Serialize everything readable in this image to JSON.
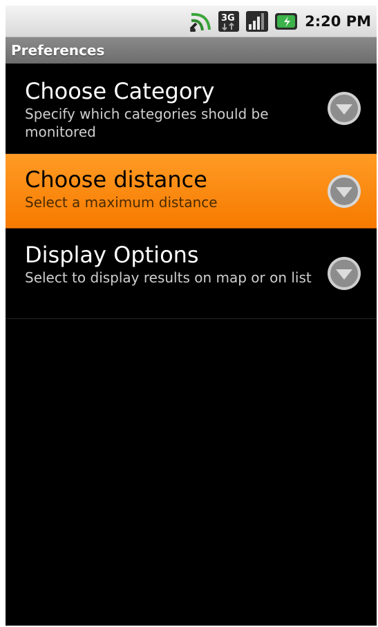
{
  "statusbar": {
    "time": "2:20 PM",
    "icons": [
      "sync-icon",
      "3g-icon",
      "signal-icon",
      "battery-icon"
    ],
    "network_label": "3G"
  },
  "titlebar": {
    "title": "Preferences"
  },
  "preferences": [
    {
      "title": "Choose Category",
      "summary": "Specify which categories should be monitored",
      "selected": false
    },
    {
      "title": "Choose distance",
      "summary": "Select a maximum distance",
      "selected": true
    },
    {
      "title": "Display Options",
      "summary": "Select to display results on map or on list",
      "selected": false
    }
  ],
  "colors": {
    "accent": "#f88300",
    "background": "#000000",
    "titlebar": "#7a7a7a"
  }
}
